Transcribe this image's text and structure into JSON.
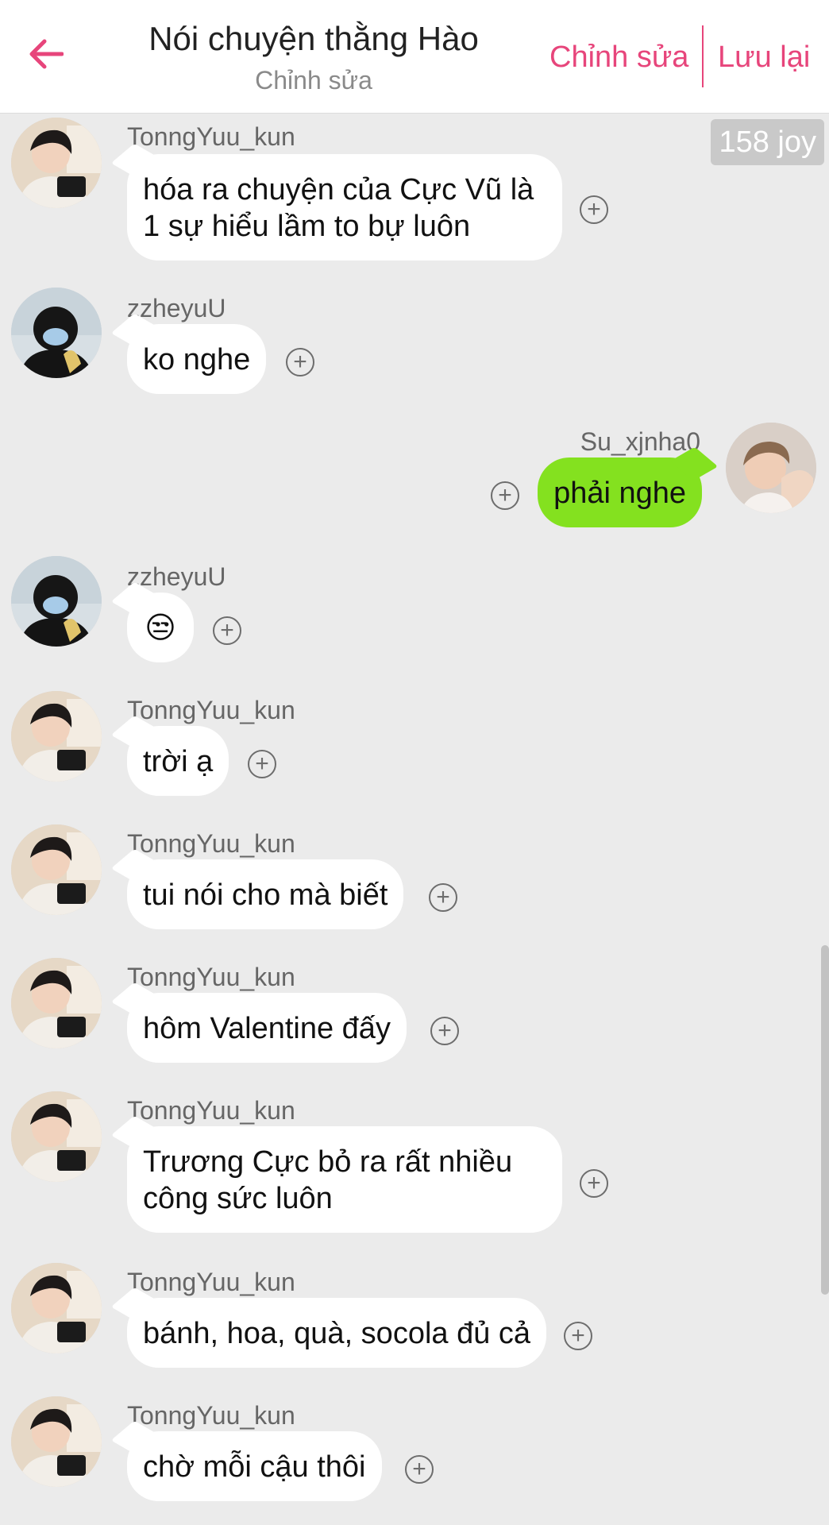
{
  "header": {
    "title": "Nói chuyện thằng Hào",
    "subtitle": "Chỉnh sửa",
    "edit_label": "Chỉnh sửa",
    "save_label": "Lưu lại",
    "accent": "#e7457b"
  },
  "badge": {
    "text": "158 joy"
  },
  "messages": [
    {
      "sender": "TonngYuu_kun",
      "text_lines": [
        "hóa ra chuyện của Cực Vũ là",
        "1 sự hiểu lầm to bự luôn"
      ]
    },
    {
      "sender": "zzheyuU",
      "text": "ko nghe"
    },
    {
      "sender": "Su_xjnha0",
      "text": "phải nghe",
      "self": true
    },
    {
      "sender": "zzheyuU",
      "text": "😒"
    },
    {
      "sender": "TonngYuu_kun",
      "text": "trời ạ"
    },
    {
      "sender": "TonngYuu_kun",
      "text": "tui nói cho mà biết"
    },
    {
      "sender": "TonngYuu_kun",
      "text": "hôm Valentine đấy"
    },
    {
      "sender": "TonngYuu_kun",
      "text_lines": [
        "Trương Cực bỏ ra rất nhiều",
        "công sức luôn"
      ]
    },
    {
      "sender": "TonngYuu_kun",
      "text": "bánh, hoa, quà, socola đủ cả"
    },
    {
      "sender": "TonngYuu_kun",
      "text": "chờ mỗi cậu thôi"
    }
  ],
  "icons": {
    "back": "back-arrow-icon",
    "add": "plus-circle-icon"
  },
  "colors": {
    "self_bubble": "#84e11f",
    "other_bubble": "#ffffff",
    "background": "#ebebeb"
  }
}
